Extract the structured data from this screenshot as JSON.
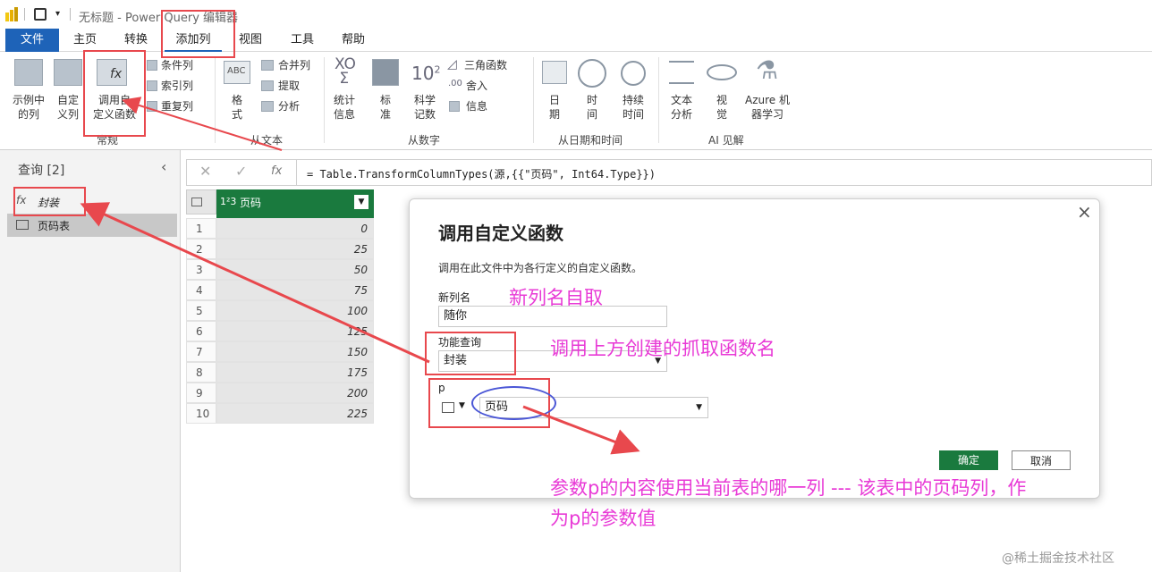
{
  "titlebar": {
    "title": "无标题 - Power Query 编辑器"
  },
  "menu": [
    "文件",
    "主页",
    "转换",
    "添加列",
    "视图",
    "工具",
    "帮助"
  ],
  "ribbon": {
    "example_col": "示例中\n的列",
    "custom_col": "自定\n义列",
    "invoke_fn": "调用自\n定义函数",
    "cond_col": "条件列",
    "index_col": "索引列",
    "dup_col": "重复列",
    "group_general": "常规",
    "format": "格\n式",
    "merge_col": "合并列",
    "extract": "提取",
    "parse": "分析",
    "group_text": "从文本",
    "stats": "统计\n信息",
    "standard": "标\n准",
    "scientific": "科学\n记数",
    "trig": "三角函数",
    "round": "舍入",
    "info": "信息",
    "group_number": "从数字",
    "date": "日\n期",
    "time": "时\n间",
    "duration": "持续\n时间",
    "group_datetime": "从日期和时间",
    "text_analysis": "文本\n分析",
    "vision": "视\n觉",
    "azure_ml": "Azure 机\n器学习",
    "group_ai": "AI 见解"
  },
  "queries": {
    "header": "查询 [2]",
    "items": [
      {
        "label": "封装",
        "type": "function"
      },
      {
        "label": "页码表",
        "type": "table"
      }
    ]
  },
  "formula": "= Table.TransformColumnTypes(源,{{\"页码\", Int64.Type}})",
  "table": {
    "column_header": "页码",
    "type_glyph": "1²3",
    "rows": [
      {
        "n": "1",
        "v": "0"
      },
      {
        "n": "2",
        "v": "25"
      },
      {
        "n": "3",
        "v": "50"
      },
      {
        "n": "4",
        "v": "75"
      },
      {
        "n": "5",
        "v": "100"
      },
      {
        "n": "6",
        "v": "125"
      },
      {
        "n": "7",
        "v": "150"
      },
      {
        "n": "8",
        "v": "175"
      },
      {
        "n": "9",
        "v": "200"
      },
      {
        "n": "10",
        "v": "225"
      }
    ]
  },
  "dialog": {
    "title": "调用自定义函数",
    "desc": "调用在此文件中为各行定义的自定义函数。",
    "newcol_label": "新列名",
    "newcol_value": "随你",
    "fnquery_label": "功能查询",
    "fnquery_value": "封装",
    "param_label": "p",
    "param_value": "页码",
    "ok": "确定",
    "cancel": "取消"
  },
  "annotations": {
    "a1": "新列名自取",
    "a2": "调用上方创建的抓取函数名",
    "a3_line1": "参数p的内容使用当前表的哪一列 --- 该表中的页码列，作",
    "a3_line2": "为p的参数值"
  },
  "watermark": "@稀土掘金技术社区",
  "colors": {
    "accent": "#1e63b8",
    "annotation": "#e83ad6",
    "redbox": "#e8484d",
    "ok_button": "#1a7a3e",
    "column_header": "#1a7a3e"
  }
}
